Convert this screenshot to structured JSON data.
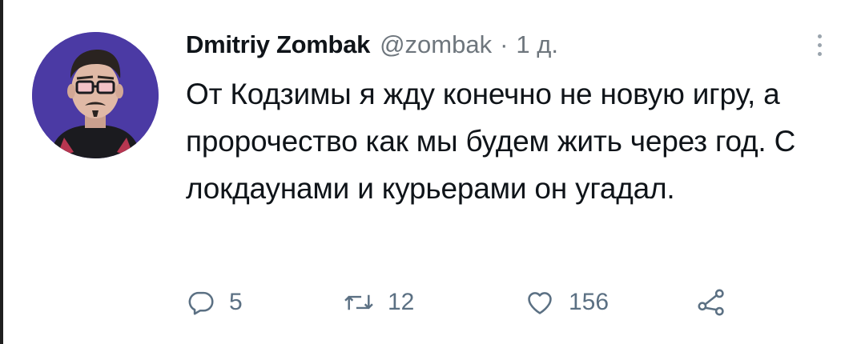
{
  "tweet": {
    "display_name": "Dmitriy Zombak",
    "handle": "@zombak",
    "separator": "·",
    "time": "1 д.",
    "text": "От Кодзимы я жду конечно не новую игру, а пророчество как мы будем жить через год. С локдаунами и курьерами он угадал.",
    "avatar_icon": "avatar-illustration",
    "more_icon": "more-vertical-icon"
  },
  "actions": {
    "reply": {
      "icon": "reply-icon",
      "count": "5"
    },
    "retweet": {
      "icon": "retweet-icon",
      "count": "12"
    },
    "like": {
      "icon": "heart-icon",
      "count": "156"
    },
    "share": {
      "icon": "share-icon"
    }
  },
  "colors": {
    "text": "#0f1419",
    "muted": "#6e767d",
    "icon": "#5b7083",
    "avatar_bg": "#4b3aa4"
  }
}
